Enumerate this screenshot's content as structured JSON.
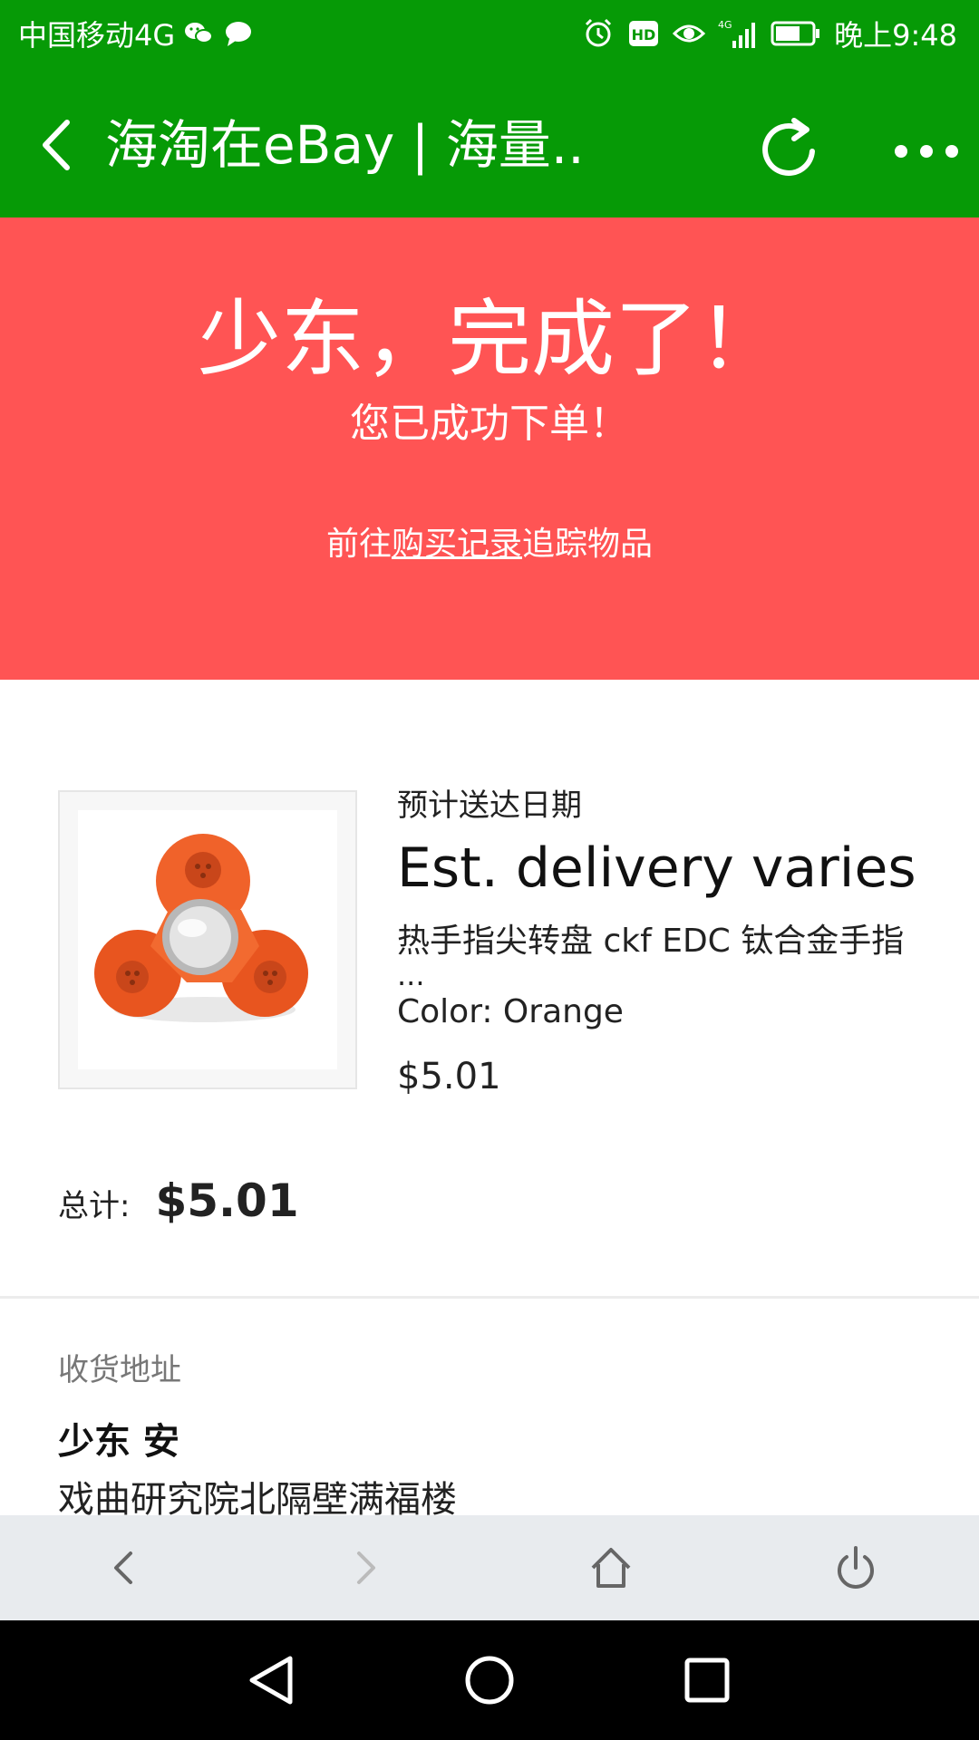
{
  "status_bar": {
    "carrier": "中国移动4G",
    "network": "4G",
    "time": "晚上9:48",
    "left_icons": [
      "wechat-icon",
      "message-icon"
    ],
    "right_icons": [
      "alarm-icon",
      "hd-icon",
      "eye-icon",
      "signal-icon",
      "battery-icon"
    ]
  },
  "title_bar": {
    "title": "海淘在eBay | 海量..",
    "back_icon": "back-arrow-icon",
    "refresh_icon": "refresh-icon",
    "more_icon": "more-dots-icon"
  },
  "hero": {
    "headline": "少东，完成了！",
    "subtitle": "您已成功下单！",
    "track_prefix": "前往",
    "track_link": "购买记录",
    "track_suffix": "追踪物品",
    "bg_color": "#ff5454"
  },
  "item": {
    "eta_label": "预计送达日期",
    "eta_value": "Est. delivery varies",
    "title": "热手指尖转盘 ckf EDC 钛合金手指",
    "title_ellipsis": "...",
    "variant": "Color: Orange",
    "price": "$5.01",
    "image_icon": "fidget-spinner-image"
  },
  "total": {
    "label": "总计:",
    "value": "$5.01"
  },
  "shipping": {
    "label": "收货地址",
    "name": "少东 安",
    "address": "戏曲研究院北隔壁满福楼"
  },
  "browser_toolbar": {
    "icons": [
      "back-icon",
      "forward-icon",
      "home-icon",
      "power-icon"
    ]
  },
  "nav_bar": {
    "icons": [
      "nav-back-icon",
      "nav-home-icon",
      "nav-recents-icon"
    ]
  },
  "colors": {
    "brand_green": "#069a06",
    "hero_red": "#ff5454",
    "toolbar_gray": "#e8ebee"
  }
}
